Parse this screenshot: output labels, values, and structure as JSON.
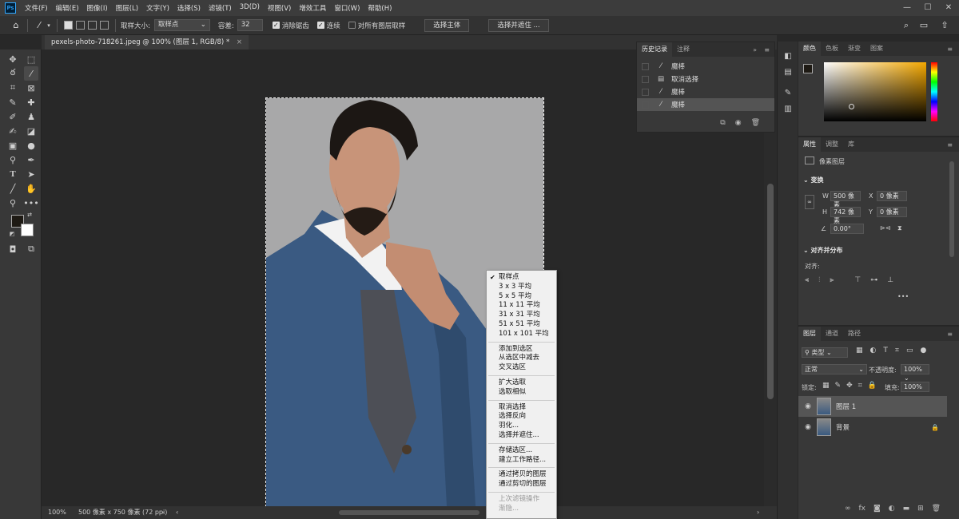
{
  "menubar": {
    "logo": "Ps",
    "items": [
      "文件(F)",
      "编辑(E)",
      "图像(I)",
      "图层(L)",
      "文字(Y)",
      "选择(S)",
      "滤镜(T)",
      "3D(D)",
      "视图(V)",
      "增效工具",
      "窗口(W)",
      "帮助(H)"
    ],
    "window_controls": [
      "—",
      "☐",
      "✕"
    ]
  },
  "options": {
    "sample_size_label": "取样大小:",
    "sample_size_value": "取样点",
    "tolerance_label": "容差:",
    "tolerance_value": "32",
    "antialias_label": "消除锯齿",
    "antialias_checked": true,
    "contiguous_label": "连续",
    "contiguous_checked": true,
    "all_layers_label": "对所有图层取样",
    "all_layers_checked": false,
    "select_subject": "选择主体",
    "select_and_mask": "选择并遮住 ..."
  },
  "document": {
    "tab_title": "pexels-photo-718261.jpeg @ 100% (图层 1, RGB/8) *",
    "zoom": "100%",
    "info": "500 像素 x 750 像素 (72 ppi)"
  },
  "history": {
    "tabs": [
      "历史记录",
      "注释"
    ],
    "items": [
      {
        "label": "魔棒",
        "icon": "magic-wand-icon",
        "selected": false
      },
      {
        "label": "取消选择",
        "icon": "document-icon",
        "selected": false
      },
      {
        "label": "魔棒",
        "icon": "magic-wand-icon",
        "selected": false
      },
      {
        "label": "魔棒",
        "icon": "magic-wand-icon",
        "selected": true
      }
    ]
  },
  "color_panel": {
    "tabs": [
      "颜色",
      "色板",
      "渐变",
      "图案"
    ],
    "hue_color": "#f4a800"
  },
  "properties": {
    "tabs": [
      "属性",
      "调整",
      "库"
    ],
    "layer_type": "像素图层",
    "transform_title": "变换",
    "w_label": "W",
    "w_value": "500 像素",
    "x_label": "X",
    "x_value": "0 像素",
    "h_label": "H",
    "h_value": "742 像素",
    "y_label": "Y",
    "y_value": "0 像素",
    "angle_value": "0.00°",
    "align_title": "对齐并分布",
    "align_label": "对齐:",
    "more": "•••"
  },
  "layers": {
    "tabs": [
      "图层",
      "通道",
      "路径"
    ],
    "filter_kind": "类型",
    "blend_mode": "正常",
    "opacity_label": "不透明度:",
    "opacity_value": "100%",
    "lock_label": "锁定:",
    "fill_label": "填充:",
    "fill_value": "100%",
    "items": [
      {
        "name": "图层 1",
        "selected": true
      },
      {
        "name": "背景",
        "selected": false
      }
    ]
  },
  "context_menu": {
    "groups": [
      [
        {
          "label": "取样点",
          "checked": true
        },
        {
          "label": "3 x 3 平均"
        },
        {
          "label": "5 x 5 平均"
        },
        {
          "label": "11 x 11 平均"
        },
        {
          "label": "31 x 31 平均"
        },
        {
          "label": "51 x 51 平均"
        },
        {
          "label": "101 x 101 平均"
        }
      ],
      [
        {
          "label": "添加到选区"
        },
        {
          "label": "从选区中减去"
        },
        {
          "label": "交叉选区"
        }
      ],
      [
        {
          "label": "扩大选取"
        },
        {
          "label": "选取相似"
        }
      ],
      [
        {
          "label": "取消选择"
        },
        {
          "label": "选择反向"
        },
        {
          "label": "羽化..."
        },
        {
          "label": "选择并遮住..."
        }
      ],
      [
        {
          "label": "存储选区..."
        },
        {
          "label": "建立工作路径..."
        }
      ],
      [
        {
          "label": "通过拷贝的图层"
        },
        {
          "label": "通过剪切的图层"
        }
      ],
      [
        {
          "label": "上次滤镜操作",
          "disabled": true
        },
        {
          "label": "渐隐...",
          "disabled": true
        }
      ]
    ]
  }
}
